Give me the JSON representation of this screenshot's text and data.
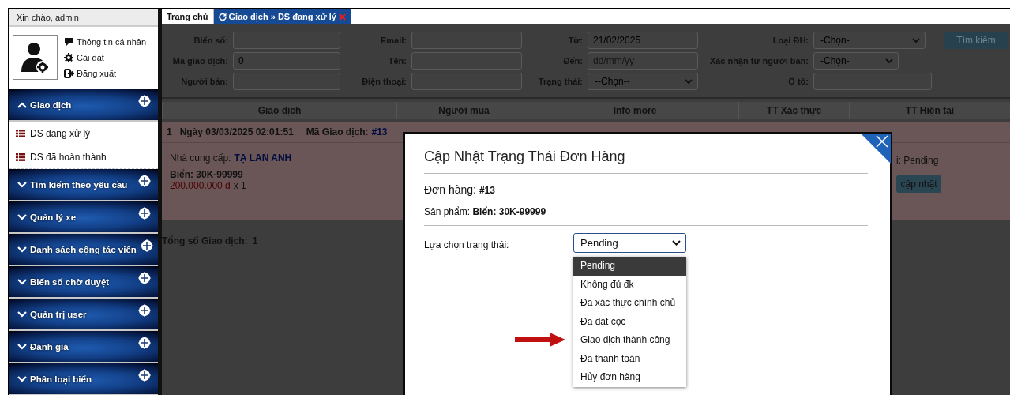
{
  "sidebar": {
    "greeting": "Xin chào, admin",
    "profile_links": [
      {
        "kind": "comment",
        "label": "Thông tin cá nhân"
      },
      {
        "kind": "gear",
        "label": "Cài đặt"
      },
      {
        "kind": "logout",
        "label": "Đăng xuất"
      }
    ],
    "menu": [
      {
        "label": "Giao dịch",
        "expanded": true,
        "children": [
          {
            "label": "DS đang xử lý"
          },
          {
            "label": "DS đã hoàn thành"
          }
        ]
      },
      {
        "label": "Tìm kiếm theo yêu cầu",
        "expanded": false
      },
      {
        "label": "Quản lý xe",
        "expanded": false
      },
      {
        "label": "Danh sách cộng tác viên",
        "expanded": false
      },
      {
        "label": "Biển số chờ duyệt",
        "expanded": false
      },
      {
        "label": "Quản trị user",
        "expanded": false
      },
      {
        "label": "Đánh giá",
        "expanded": false
      },
      {
        "label": "Phân loại biển",
        "expanded": false
      }
    ]
  },
  "tabs": [
    {
      "label": "Trang chủ",
      "selected": false,
      "closable": false
    },
    {
      "label": "Giao dịch » DS đang xử lý",
      "selected": true,
      "closable": true
    }
  ],
  "filters": [
    {
      "kind": "text",
      "label": "Biển số:"
    },
    {
      "kind": "text",
      "label": "Email:"
    },
    {
      "kind": "text",
      "label": "Từ:",
      "value": "21/02/2025"
    },
    {
      "kind": "select",
      "label": "Loại ĐH:",
      "value": "-Chọn-"
    },
    {
      "kind": "text",
      "label": "Mã giao dịch:",
      "value": "0"
    },
    {
      "kind": "text",
      "label": "Tên:"
    },
    {
      "kind": "text",
      "label": "Đến:",
      "placeholder": "dd/mm/yy"
    },
    {
      "kind": "select",
      "label": "Xác nhận từ người bán:",
      "value": "-Chọn-"
    },
    {
      "kind": "text",
      "label": "Người bán:"
    },
    {
      "kind": "text",
      "label": "Điện thoại:"
    },
    {
      "kind": "select",
      "label": "Trạng thái:",
      "value": "--Chọn--"
    },
    {
      "kind": "text",
      "label": "Ô tô:"
    }
  ],
  "search_button": "Tìm kiếm",
  "table": {
    "columns": [
      "Giao dịch",
      "Người mua",
      "Info more",
      "TT Xác thực",
      "TT Hiện tại"
    ],
    "rows": [
      {
        "index": "1",
        "date": "Ngày 03/03/2025 02:01:51",
        "code_label": "Mã Giao dịch:",
        "code": "#13",
        "supplier_label": "Nhà cung cấp:",
        "supplier": "TẠ LAN ANH",
        "plate": "Biển: 30K-99999",
        "price": "200.000.000 đ",
        "quantity": "x 1",
        "status": "i: Pending",
        "action": "cập nhật"
      }
    ]
  },
  "total": {
    "label": "Tổng số Giao dịch:",
    "value": "1"
  },
  "modal": {
    "title": "Cập Nhật Trạng Thái Đơn Hàng",
    "order": "Đơn hàng: **#13**",
    "product": "Sản phẩm: **Biển: 30K-99999**",
    "status_label": "Lựa chọn trạng thái:",
    "status_select": {
      "value": "Pending",
      "expanded": true,
      "options": [
        {
          "label": "Pending",
          "selected": true
        },
        {
          "label": "Không đủ đk",
          "selected": false
        },
        {
          "label": "Đã xác thực chính chủ",
          "selected": false
        },
        {
          "label": "Đã đặt cọc",
          "selected": false
        },
        {
          "label": "Giao dịch thành công",
          "selected": false
        },
        {
          "label": "Đã thanh toán",
          "selected": false
        },
        {
          "label": "Hủy đơn hàng",
          "selected": false
        }
      ]
    }
  }
}
